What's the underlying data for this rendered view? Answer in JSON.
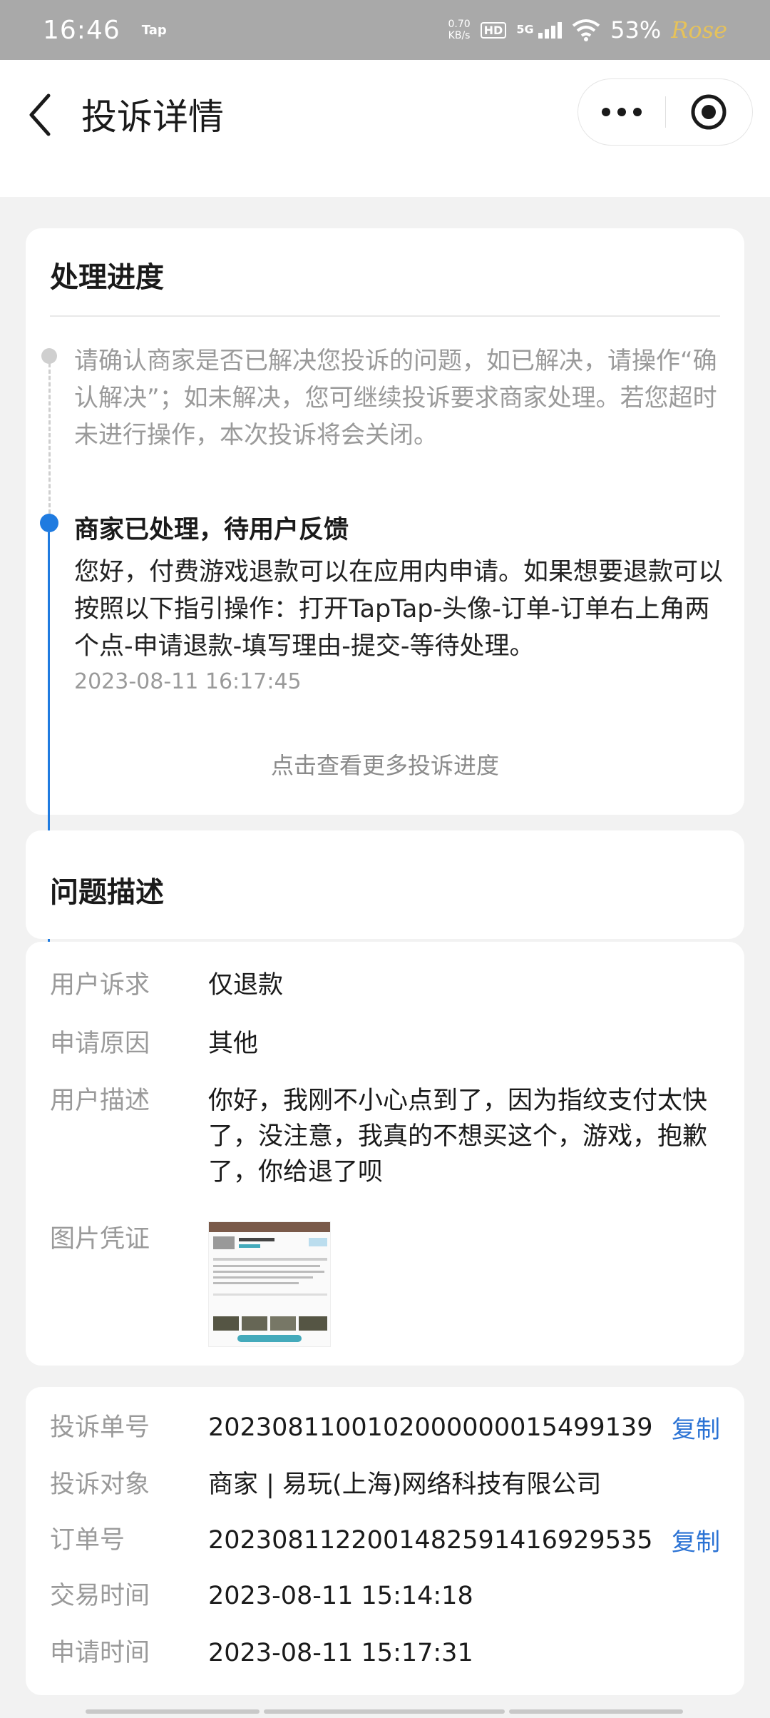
{
  "status_bar": {
    "time": "16:46",
    "tap_badge": "Tap",
    "net_speed_value": "0.70",
    "net_speed_unit": "KB/s",
    "hd": "HD",
    "network": "5G",
    "battery": "53%",
    "watermark": "Rose"
  },
  "header": {
    "title": "投诉详情"
  },
  "progress": {
    "title": "处理进度",
    "hint": "请确认商家是否已解决您投诉的问题，如已解决，请操作“确认解决”；如未解决，您可继续投诉要求商家处理。若您超时未进行操作，本次投诉将会关闭。",
    "status": "商家已处理，待用户反馈",
    "message": "您好，付费游戏退款可以在应用内申请。如果想要退款可以按照以下指引操作：打开TapTap-头像-订单-订单右上角两个点-申请退款-填写理由-提交-等待处理。",
    "timestamp": "2023-08-11 16:17:45",
    "more_link": "点击查看更多投诉进度"
  },
  "problem": {
    "title": "问题描述",
    "rows": [
      {
        "label": "用户诉求",
        "value": "仅退款"
      },
      {
        "label": "申请原因",
        "value": "其他"
      },
      {
        "label": "用户描述",
        "value": "你好，我刚不小心点到了，因为指纹支付太快了，没注意，我真的不想买这个，游戏，抱歉了，你给退了呗"
      }
    ],
    "evidence_label": "图片凭证"
  },
  "order": {
    "complaint_no_label": "投诉单号",
    "complaint_no": "2023081100102000000015499139",
    "copy_label": "复制",
    "target_label": "投诉对象",
    "target": "商家 | 易玩(上海)网络科技有限公司",
    "order_no_label": "订单号",
    "order_no": "2023081122001482591416929535",
    "trade_time_label": "交易时间",
    "trade_time": "2023-08-11 15:14:18",
    "apply_time_label": "申请时间",
    "apply_time": "2023-08-11 15:17:31"
  },
  "colors": {
    "accent_blue": "#1f7be0",
    "link_blue": "#2a72d4",
    "muted_text": "#9a9a9a",
    "page_bg": "#f2f2f2"
  }
}
